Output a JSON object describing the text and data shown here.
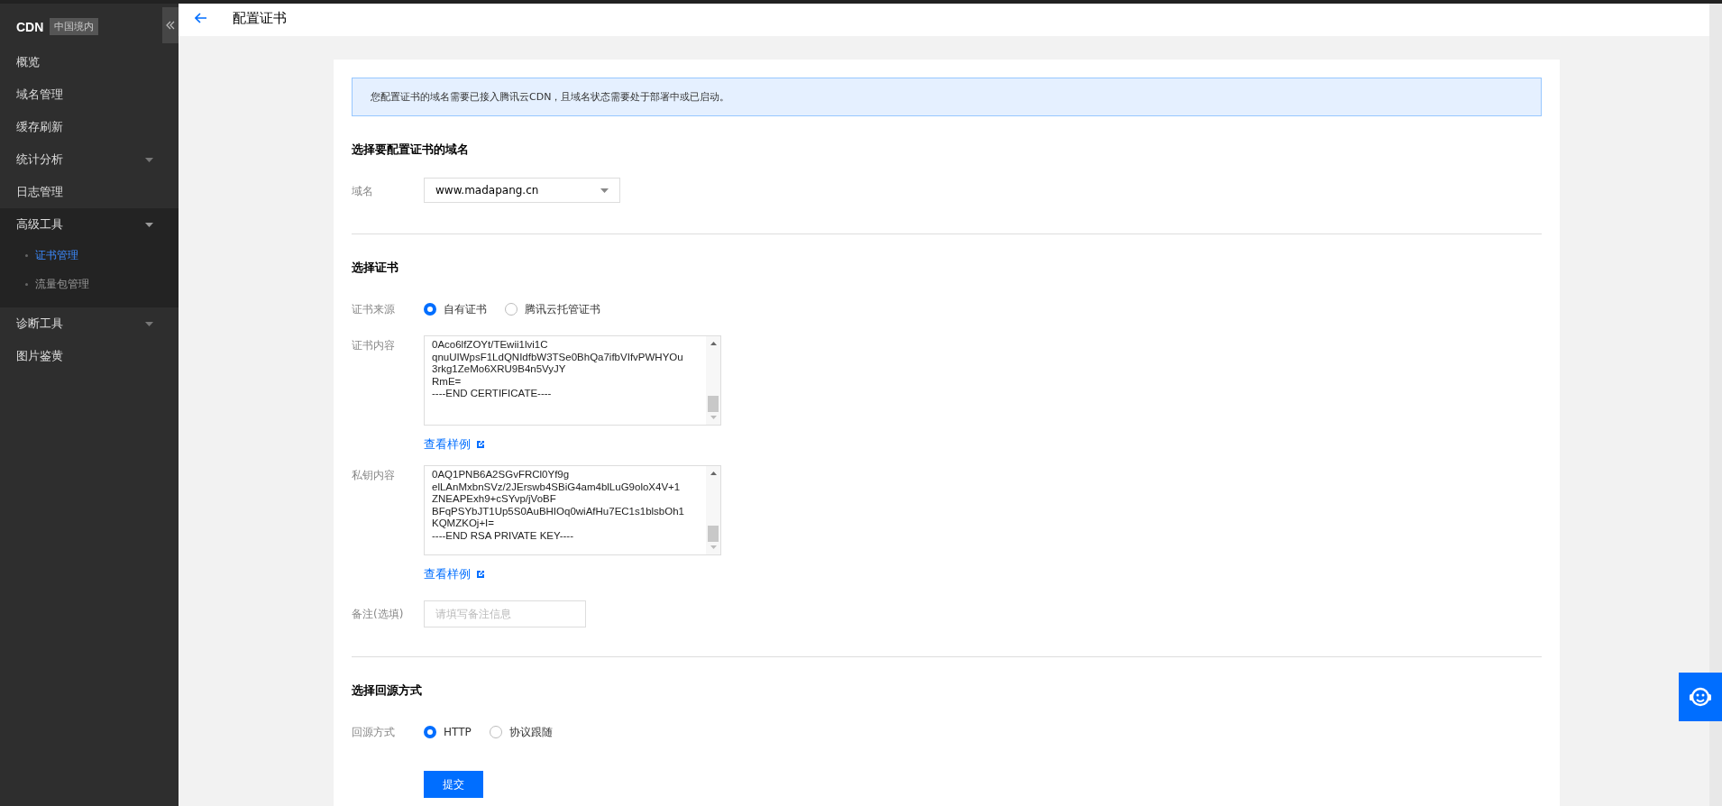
{
  "sidebar": {
    "brand": "CDN",
    "region_badge": "中国境内",
    "items": [
      {
        "kind": "link",
        "label": "概览",
        "selected": false
      },
      {
        "kind": "link",
        "label": "域名管理",
        "selected": false
      },
      {
        "kind": "link",
        "label": "缓存刷新",
        "selected": false
      },
      {
        "kind": "group",
        "label": "统计分析",
        "selected": false,
        "expanded": false
      },
      {
        "kind": "link",
        "label": "日志管理",
        "selected": false
      },
      {
        "kind": "group",
        "label": "高级工具",
        "selected": false,
        "expanded": true,
        "children": [
          {
            "label": "证书管理",
            "selected": true
          },
          {
            "label": "流量包管理",
            "selected": false
          }
        ]
      },
      {
        "kind": "group",
        "label": "诊断工具",
        "selected": false,
        "expanded": false
      },
      {
        "kind": "link",
        "label": "图片鉴黄",
        "selected": false
      }
    ]
  },
  "header": {
    "title": "配置证书"
  },
  "form": {
    "notice": "您配置证书的域名需要已接入腾讯云CDN，且域名状态需要处于部署中或已启动。",
    "sections": [
      {
        "heading": "选择要配置证书的域名",
        "fields": [
          {
            "kind": "select",
            "label": "域名",
            "value": "www.madapang.cn"
          }
        ]
      },
      {
        "heading": "选择证书",
        "fields": [
          {
            "kind": "radio",
            "label": "证书来源",
            "options": [
              {
                "label": "自有证书",
                "selected": true
              },
              {
                "label": "腾讯云托管证书",
                "selected": false
              }
            ]
          },
          {
            "kind": "textarea",
            "label": "证书内容",
            "lines": [
              "0Aco6lfZOYt/TEwii1lvi1C",
              "qnuUIWpsF1LdQNIdfbW3TSe0BhQa7ifbVIfvPWHYOu",
              "3rkg1ZeMo6XRU9B4n5VyJY",
              "RmE=",
              "----END CERTIFICATE----"
            ],
            "link": "查看样例"
          },
          {
            "kind": "textarea",
            "label": "私钥内容",
            "lines": [
              "0AQ1PNB6A2SGvFRCl0Yf9g",
              "elLAnMxbnSVz/2JErswb4SBiG4am4blLuG9oloX4V+1",
              "ZNEAPExh9+cSYvp/jVoBF",
              "BFqPSYbJT1Up5S0AuBHIOq0wiAfHu7EC1s1blsbOh1",
              "KQMZKOj+I=",
              "----END RSA PRIVATE KEY----"
            ],
            "link": "查看样例"
          },
          {
            "kind": "input",
            "label": "备注(选填)",
            "placeholder": "请填写备注信息"
          }
        ]
      },
      {
        "heading": "选择回源方式",
        "fields": [
          {
            "kind": "radio",
            "label": "回源方式",
            "options": [
              {
                "label": "HTTP",
                "selected": true
              },
              {
                "label": "协议跟随",
                "selected": false
              }
            ]
          }
        ]
      }
    ],
    "submit": "提交"
  }
}
